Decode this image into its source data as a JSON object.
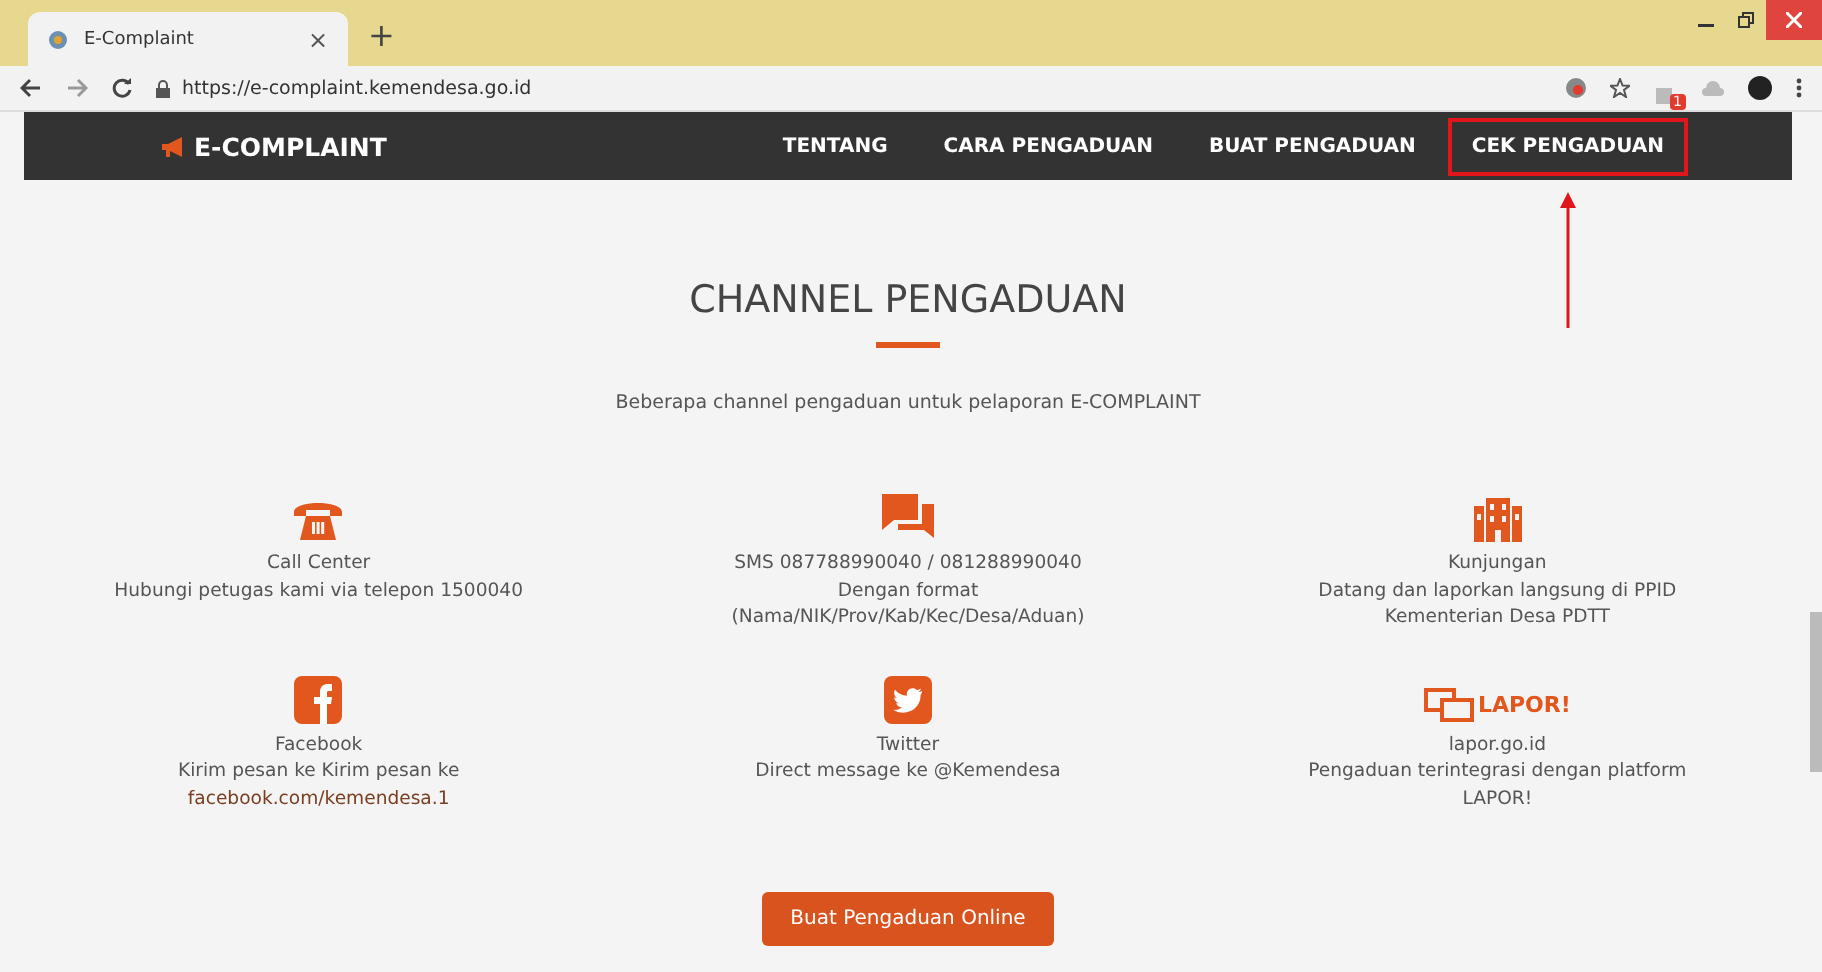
{
  "browser": {
    "tab_title": "E-Complaint",
    "tab_close": "×",
    "new_tab": "+",
    "url": "https://e-complaint.kemendesa.go.id",
    "extension_badge": "1"
  },
  "navbar": {
    "brand": "E-COMPLAINT",
    "items": [
      {
        "label": "TENTANG",
        "highlighted": false
      },
      {
        "label": "CARA PENGADUAN",
        "highlighted": false
      },
      {
        "label": "BUAT PENGADUAN",
        "highlighted": false
      },
      {
        "label": "CEK PENGADUAN",
        "highlighted": true
      }
    ]
  },
  "section": {
    "title": "CHANNEL PENGADUAN",
    "subtitle": "Beberapa channel pengaduan untuk pelaporan E-COMPLAINT"
  },
  "channels": [
    {
      "kind": "phone",
      "name": "Call Center",
      "lines": [
        "Hubungi petugas kami via telepon 1500040"
      ]
    },
    {
      "kind": "sms",
      "name": "SMS 087788990040 / 081288990040",
      "lines": [
        "Dengan format",
        "(Nama/NIK/Prov/Kab/Kec/Desa/Aduan)"
      ]
    },
    {
      "kind": "building",
      "name": "Kunjungan",
      "lines": [
        "Datang dan laporkan langsung di PPID",
        "Kementerian Desa PDTT"
      ]
    },
    {
      "kind": "facebook",
      "name": "Facebook",
      "lines": [
        "Kirim pesan ke Kirim pesan ke"
      ],
      "link": "facebook.com/kemendesa.1"
    },
    {
      "kind": "twitter",
      "name": "Twitter",
      "lines": [
        "Direct message ke @Kemendesa"
      ]
    },
    {
      "kind": "lapor",
      "logo_text": "LAPOR!",
      "name": "lapor.go.id",
      "lines": [
        "Pengaduan terintegrasi dengan platform",
        "LAPOR!"
      ]
    }
  ],
  "cta_button": "Buat Pengaduan Online"
}
